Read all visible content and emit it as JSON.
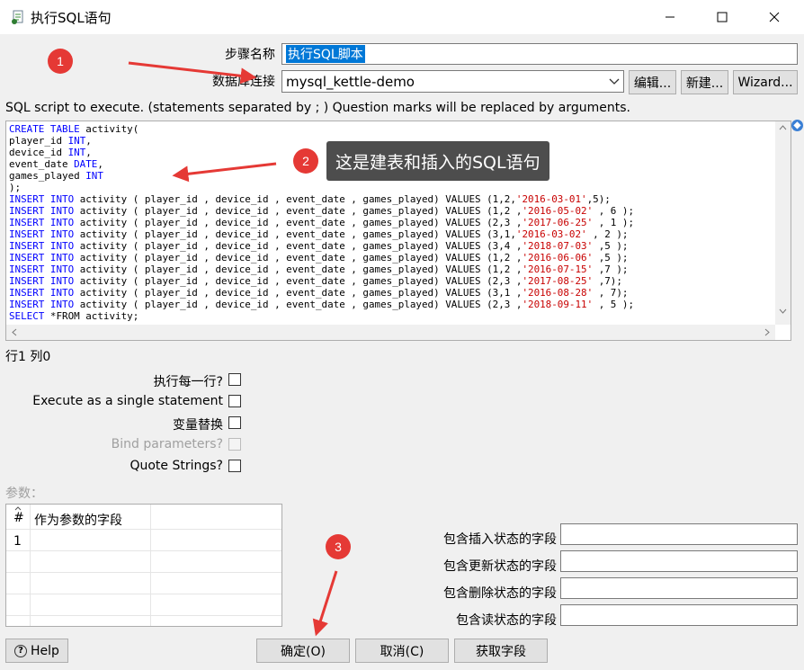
{
  "window": {
    "title": "执行SQL语句",
    "minimize_icon": "minimize-icon",
    "maximize_icon": "maximize-icon",
    "close_icon": "close-icon"
  },
  "form": {
    "step_name_label": "步骤名称",
    "step_name_value": "执行SQL脚本",
    "connection_label": "数据库连接",
    "connection_value": "mysql_kettle-demo",
    "edit_button": "编辑...",
    "new_button": "新建...",
    "wizard_button": "Wizard...",
    "sql_caption": "SQL script to execute. (statements separated by ; ) Question marks will be replaced by arguments."
  },
  "sql": {
    "create_lines": [
      "CREATE TABLE activity(",
      "player_id INT,",
      "device_id INT,",
      "event_date DATE,",
      "games_played INT",
      ");"
    ],
    "insert_rows": [
      {
        "vals": "1,2,",
        "date": "'2016-03-01'",
        "tail": ",5);"
      },
      {
        "vals": "1,2 ,",
        "date": "'2016-05-02'",
        "tail": " , 6 );"
      },
      {
        "vals": "2,3 ,",
        "date": "'2017-06-25'",
        "tail": " , 1 );"
      },
      {
        "vals": "3,1,",
        "date": "'2016-03-02'",
        "tail": " , 2 );"
      },
      {
        "vals": "3,4 ,",
        "date": "'2018-07-03'",
        "tail": " ,5 );"
      },
      {
        "vals": "1,2 ,",
        "date": "'2016-06-06'",
        "tail": " ,5 );"
      },
      {
        "vals": "1,2 ,",
        "date": "'2016-07-15'",
        "tail": " ,7 );"
      },
      {
        "vals": "2,3 ,",
        "date": "'2017-08-25'",
        "tail": " ,7);"
      },
      {
        "vals": "3,1 ,",
        "date": "'2016-08-28'",
        "tail": " , 7);"
      },
      {
        "vals": "2,3 ,",
        "date": "'2018-09-11'",
        "tail": " , 5 );"
      }
    ],
    "insert_prefix": "INSERT INTO",
    "insert_middle": " activity ( player_id , device_id , event_date , games_played) VALUES (",
    "select_kw": "SELECT",
    "select_rest": " *FROM activity;"
  },
  "cursor_position": "行1 列0",
  "options": {
    "execute_each_row": "执行每一行?",
    "single_statement": "Execute as a single statement",
    "variable_substitution": "变量替换",
    "bind_parameters": "Bind parameters?",
    "quote_strings": "Quote Strings?"
  },
  "params": {
    "section_label": "参数：",
    "col_hash": "#",
    "col_field": "作为参数的字段",
    "row1_index": "1"
  },
  "status_fields": {
    "insert": "包含插入状态的字段",
    "update": "包含更新状态的字段",
    "delete": "包含删除状态的字段",
    "read": "包含读状态的字段"
  },
  "buttons": {
    "help": "Help",
    "ok": "确定(O)",
    "cancel": "取消(C)",
    "get_fields": "获取字段"
  },
  "annotations": {
    "one": "1",
    "two": "2",
    "two_text": "这是建表和插入的SQL语句",
    "three": "3",
    "color": "#e53935"
  }
}
